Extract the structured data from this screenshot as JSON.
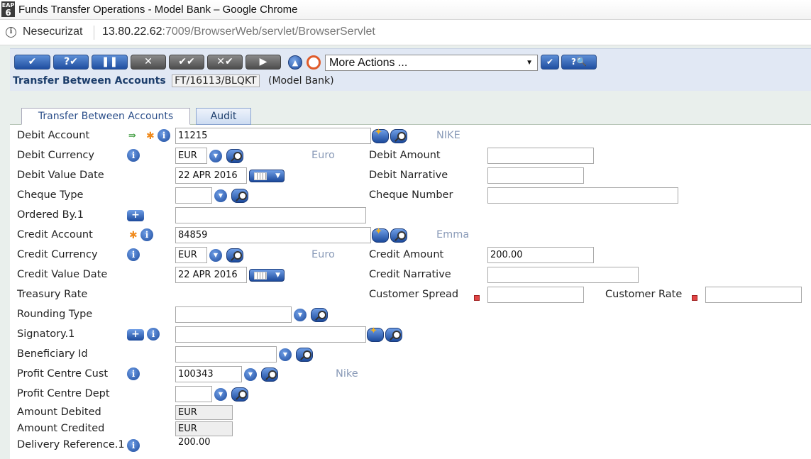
{
  "window": {
    "title": "Funds Transfer Operations - Model Bank – Google Chrome",
    "app_icon_text": "EAP",
    "app_icon_num": "6"
  },
  "address_bar": {
    "security": "Nesecurizat",
    "url_host": "13.80.22.62",
    "url_rest": ":7009/BrowserWeb/servlet/BrowserServlet"
  },
  "toolbar": {
    "buttons": [
      {
        "name": "commit",
        "glyph": "✔"
      },
      {
        "name": "validate",
        "glyph": "?✔"
      },
      {
        "name": "hold",
        "glyph": "❚❚"
      },
      {
        "name": "delete",
        "glyph": "✕"
      },
      {
        "name": "authorise",
        "glyph": "✔✔"
      },
      {
        "name": "reverse",
        "glyph": "✕✔"
      },
      {
        "name": "next",
        "glyph": "▶"
      }
    ],
    "more_actions": "More Actions ...",
    "caret": "▼"
  },
  "transaction": {
    "title": "Transfer Between Accounts",
    "id": "FT/16113/BLQKT",
    "company": "(Model Bank)"
  },
  "tabs": [
    {
      "label": "Transfer Between Accounts"
    },
    {
      "label": "Audit"
    }
  ],
  "form": {
    "debit_account": {
      "label": "Debit Account",
      "value": "11215",
      "desc": "NIKE"
    },
    "debit_currency": {
      "label": "Debit Currency",
      "value": "EUR",
      "desc": "Euro"
    },
    "debit_amount": {
      "label": "Debit Amount",
      "value": ""
    },
    "debit_value_date": {
      "label": "Debit Value Date",
      "value": "22 APR 2016"
    },
    "debit_narrative": {
      "label": "Debit Narrative",
      "value": ""
    },
    "cheque_type": {
      "label": "Cheque Type",
      "value": ""
    },
    "cheque_number": {
      "label": "Cheque Number",
      "value": ""
    },
    "ordered_by": {
      "label": "Ordered By.1",
      "value": ""
    },
    "credit_account": {
      "label": "Credit Account",
      "value": "84859",
      "desc": "Emma"
    },
    "credit_currency": {
      "label": "Credit Currency",
      "value": "EUR",
      "desc": "Euro"
    },
    "credit_amount": {
      "label": "Credit Amount",
      "value": "200.00"
    },
    "credit_value_date": {
      "label": "Credit Value Date",
      "value": "22 APR 2016"
    },
    "credit_narrative": {
      "label": "Credit Narrative",
      "value": ""
    },
    "treasury_rate": {
      "label": "Treasury Rate"
    },
    "customer_spread": {
      "label": "Customer Spread",
      "value": ""
    },
    "customer_rate": {
      "label": "Customer Rate",
      "value": ""
    },
    "rounding_type": {
      "label": "Rounding Type",
      "value": ""
    },
    "signatory": {
      "label": "Signatory.1",
      "value": ""
    },
    "beneficiary_id": {
      "label": "Beneficiary Id",
      "value": ""
    },
    "profit_centre_cust": {
      "label": "Profit Centre Cust",
      "value": "100343",
      "desc": "Nike"
    },
    "profit_centre_dept": {
      "label": "Profit Centre Dept",
      "value": ""
    },
    "amount_debited": {
      "label": "Amount Debited",
      "value": "EUR 200.00"
    },
    "amount_credited": {
      "label": "Amount Credited",
      "value": "EUR 200.00"
    },
    "delivery_reference": {
      "label": "Delivery Reference.1"
    }
  },
  "icons": {
    "info": "i",
    "plus": "+",
    "dropdown": "▼",
    "calendar_arrow": "▼",
    "star": "✱",
    "arrow": "⇛",
    "up": "▲",
    "help": "◯"
  },
  "colors": {
    "accent": "#1c4a9c",
    "desc_text": "#8a9bb8",
    "mandatory": "#f08a1c"
  }
}
